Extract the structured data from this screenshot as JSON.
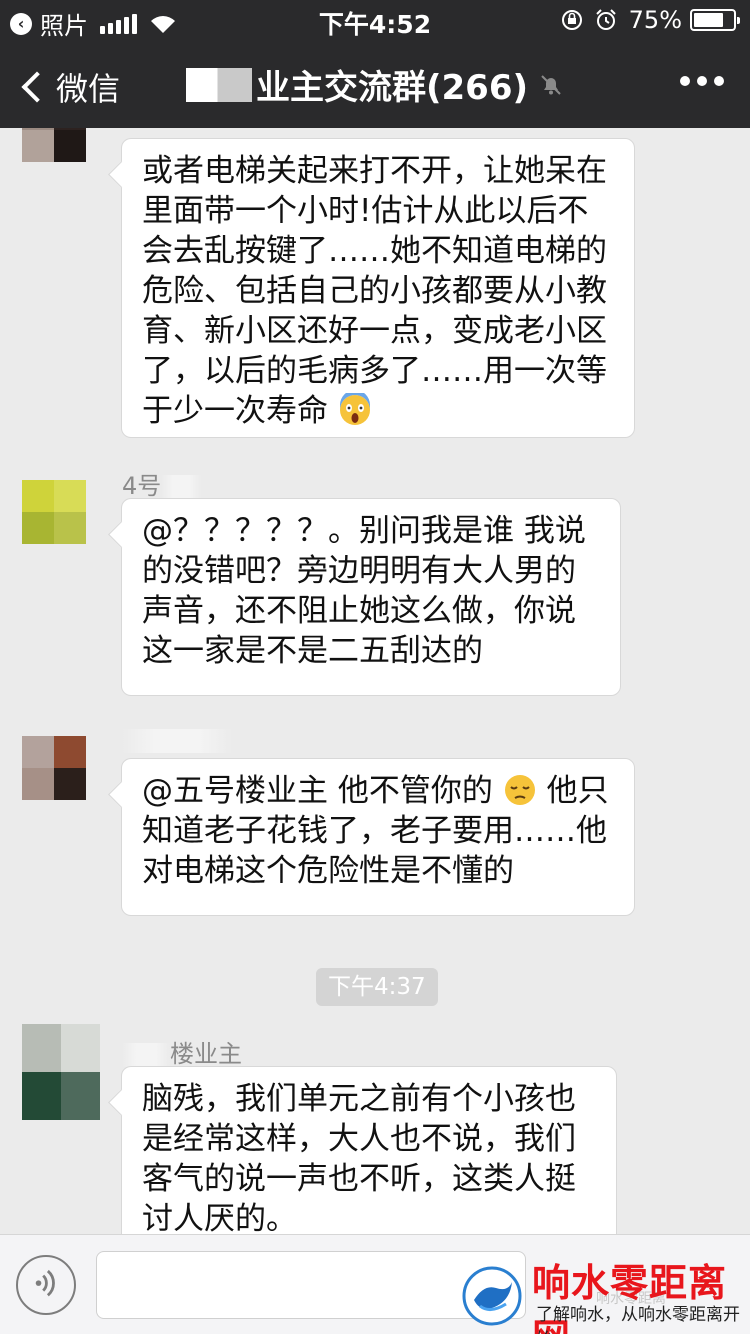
{
  "status_bar": {
    "back_app": "照片",
    "time": "下午4:52",
    "battery": "75%",
    "battery_level": 0.75
  },
  "nav": {
    "back_label": "微信",
    "title": "业主交流群(266)"
  },
  "messages": [
    {
      "sender": "",
      "text": "或者电梯关起来打不开，让她呆在里面带一个小时!估计从此以后不会去乱按键了……她不知道电梯的危险、包括自己的小孩都要从小教育、新小区还好一点，变成老小区了，以后的毛病多了……用一次等于少一次寿命",
      "emoji": "screaming-face"
    },
    {
      "sender": "4号",
      "text": "@？？？？？。别问我是谁 我说的没错吧？旁边明明有大人男的声音，还不阻止她这么做，你说这一家是不是二五刮达的"
    },
    {
      "sender": "",
      "text_before": "@五号楼业主 他不管你的",
      "emoji": "pensive-face",
      "text_after": "他只知道老子花钱了，老子要用……他对电梯这个危险性是不懂的"
    },
    {
      "sender": "楼业主",
      "text": "脑残，我们单元之前有个小孩也是经常这样，大人也不说，我们客气的说一声也不听，这类人挺讨人厌的。"
    }
  ],
  "timestamp": "下午4:37",
  "watermark": {
    "title": "响水零距离网",
    "subtitle": "了解响水，从响水零距离开始",
    "ghost": "响水零距离"
  },
  "colors": {
    "topbar": "#2a2a2c",
    "chat_bg": "#ebebeb",
    "bubble": "#ffffff",
    "timestamp_bg": "#d4d4d4",
    "watermark_red": "#e8161c"
  },
  "icons": [
    "back-to-app-icon",
    "signal-icon",
    "wifi-icon",
    "orientation-lock-icon",
    "alarm-icon",
    "battery-icon",
    "chevron-left-icon",
    "mute-bell-icon",
    "more-dots-icon",
    "voice-icon"
  ]
}
